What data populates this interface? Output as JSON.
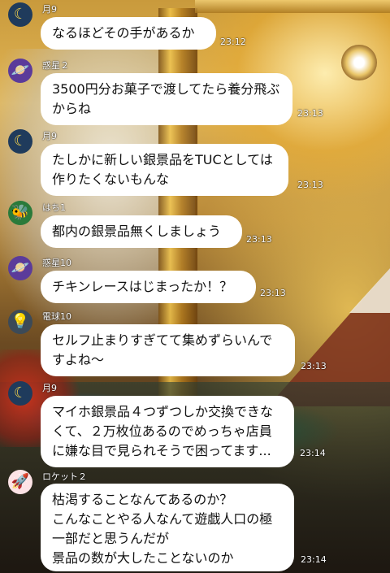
{
  "messages": [
    {
      "sender": "月9",
      "avatar_icon": "moon-icon",
      "text": "なるほどその手があるか",
      "time": "23:12"
    },
    {
      "sender": "惑星２",
      "avatar_icon": "saturn-icon",
      "text": "3500円分お菓子で渡してたら養分飛ぶからね",
      "time": "23:13"
    },
    {
      "sender": "月9",
      "avatar_icon": "moon-icon",
      "text": "たしかに新しい銀景品をTUCとしては作りたくないもんな",
      "time": "23:13"
    },
    {
      "sender": "はち1",
      "avatar_icon": "bee-icon",
      "text": "都内の銀景品無くしましょう",
      "time": "23:13"
    },
    {
      "sender": "惑星10",
      "avatar_icon": "saturn-icon",
      "text": "チキンレースはじまったか！？",
      "time": "23:13"
    },
    {
      "sender": "電球10",
      "avatar_icon": "lightbulb-icon",
      "text": "セルフ止まりすぎてて集めずらいんですよね〜",
      "time": "23:13"
    },
    {
      "sender": "月9",
      "avatar_icon": "moon-icon",
      "text": "マイホ銀景品４つずつしか交換できなくて、２万枚位あるのでめっちゃ店員に嫌な目で見られそうで困ってます...",
      "time": "23:14"
    },
    {
      "sender": "ロケット２",
      "avatar_icon": "rocket-icon",
      "text": "枯渇することなんてあるのか？\nこんなことやる人なんて遊戯人口の極一部だと思うんだが\n景品の数が大したことないのか",
      "time": "23:14"
    }
  ]
}
